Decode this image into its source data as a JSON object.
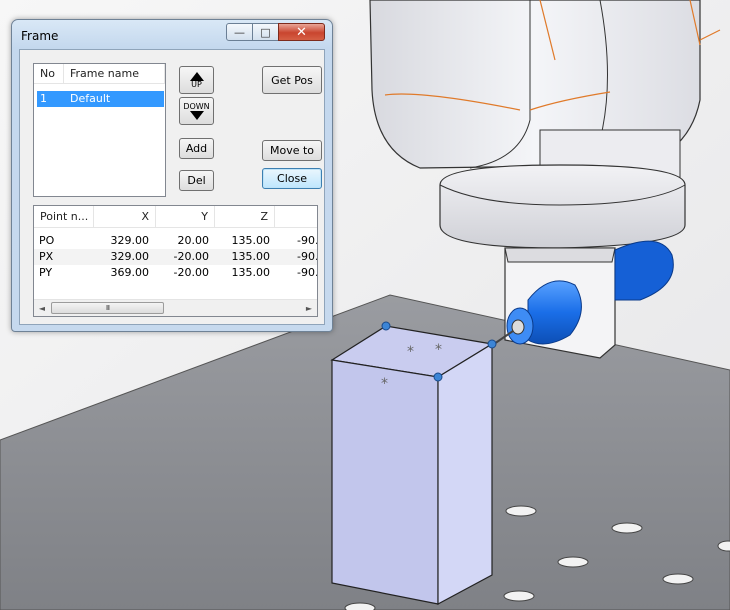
{
  "window": {
    "title": "Frame",
    "minimize_glyph": "—",
    "maximize_glyph": "□",
    "close_glyph": "✕"
  },
  "frame_list": {
    "columns": [
      "No",
      "Frame name"
    ],
    "rows": [
      {
        "no": "1",
        "name": "Default",
        "selected": true
      }
    ]
  },
  "buttons": {
    "up": "UP",
    "down": "DOWN",
    "add": "Add",
    "del": "Del",
    "get_pos": "Get Pos",
    "move_to": "Move to",
    "close": "Close"
  },
  "point_table": {
    "columns": [
      "Point n...",
      "X",
      "Y",
      "Z",
      ""
    ],
    "rows": [
      {
        "name": "PO",
        "x": "329.00",
        "y": "20.00",
        "z": "135.00",
        "extra": "-90."
      },
      {
        "name": "PX",
        "x": "329.00",
        "y": "-20.00",
        "z": "135.00",
        "extra": "-90."
      },
      {
        "name": "PY",
        "x": "369.00",
        "y": "-20.00",
        "z": "135.00",
        "extra": "-90."
      }
    ],
    "scroll_left": "◄",
    "scroll_right": "►",
    "scroll_grip": "III"
  },
  "scene": {
    "floor_color": "#8c8e94",
    "block_front_color": "#c2c6ec",
    "block_side_color": "#d3d7f6",
    "block_top_color": "#c9ccef",
    "tool_color": "#1a6ee8",
    "point_marker_color": "#3c85d6",
    "feature_edge_color": "#e07a2a"
  }
}
